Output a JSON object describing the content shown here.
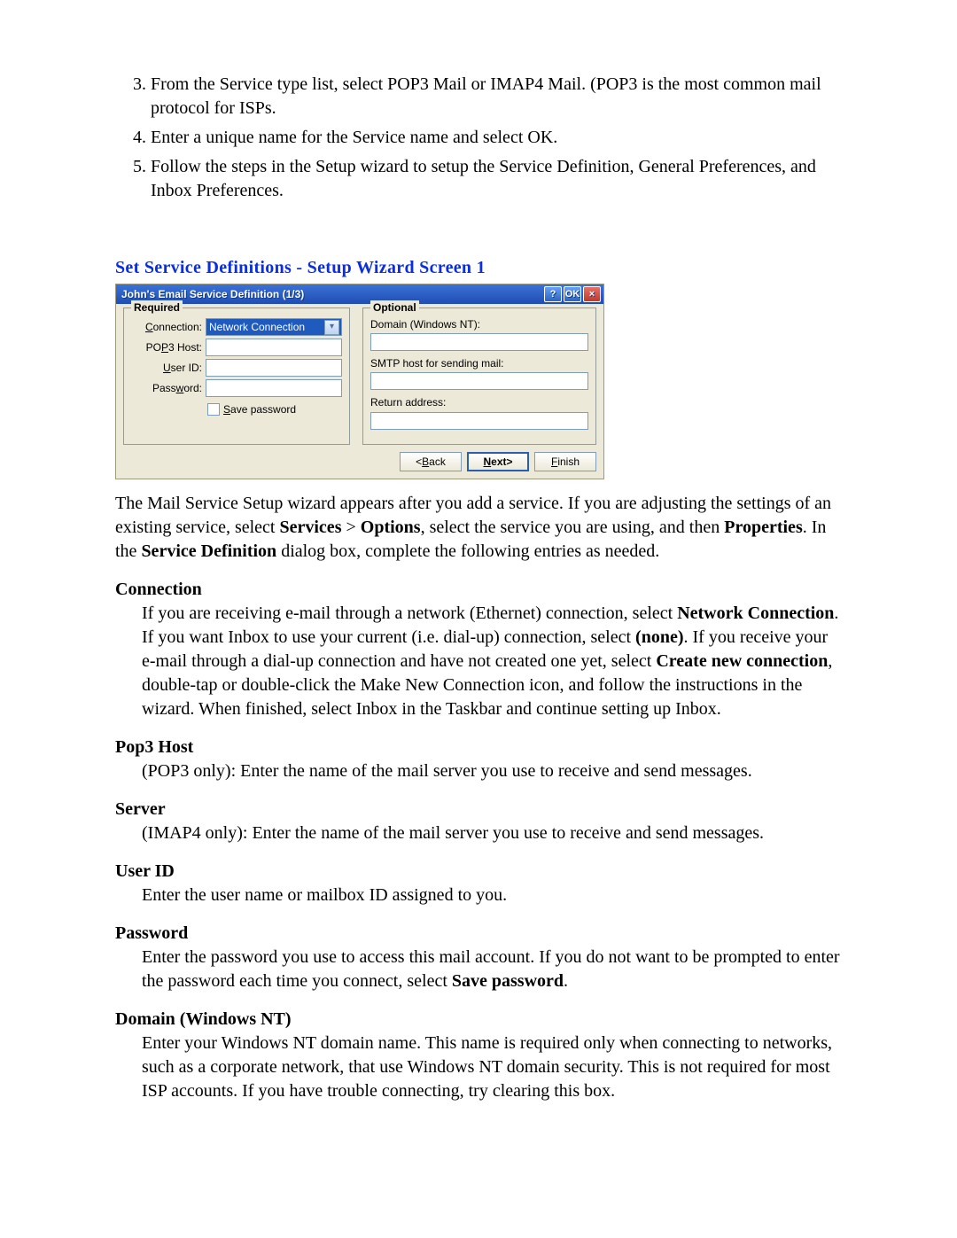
{
  "list": {
    "item3": "From the Service type list, select POP3 Mail or IMAP4 Mail. (POP3 is the most common mail protocol for ISPs.",
    "item4": "Enter a unique name for the Service name and select OK.",
    "item5": "Follow the steps in the Setup wizard to setup the Service Definition, General Preferences, and Inbox Preferences."
  },
  "section_heading": "Set Service Definitions  -   Setup Wizard Screen 1",
  "wizard": {
    "title": "John's Email Service Definition (1/3)",
    "help_btn": "?",
    "ok_btn": "OK",
    "close_btn": "×",
    "required_legend": "Required",
    "optional_legend": "Optional",
    "connection_label": "Connection:",
    "connection_value": "Network Connection",
    "pop3_label_pre": "PO",
    "pop3_label_u": "P",
    "pop3_label_post": "3 Host:",
    "userid_label_u": "U",
    "userid_label_post": "ser ID:",
    "password_label_pre": "Pass",
    "password_label_u": "w",
    "password_label_post": "ord:",
    "save_pw_u": "S",
    "save_pw_post": "ave password",
    "domain_label": "Domain (Windows NT):",
    "smtp_label": "SMTP host for sending mail:",
    "return_label": "Return address:",
    "back_btn_pre": "<",
    "back_btn_u": "B",
    "back_btn_post": "ack",
    "next_btn_pre": "",
    "next_btn_u": "N",
    "next_btn_post": "ext>",
    "finish_btn_u": "F",
    "finish_btn_post": "inish"
  },
  "para_after": {
    "p1_pre": "The Mail Service Setup wizard appears after you add a service.  If you are adjusting the settings of an existing service, select ",
    "p1_services": "Services",
    "p1_gt": " > ",
    "p1_options": "Options",
    "p1_mid1": ", select the service you are using, and then ",
    "p1_properties": "Properties",
    "p1_mid2": ". In the ",
    "p1_sdef": "Service Definition",
    "p1_post": " dialog box, complete the following entries as needed."
  },
  "defs": {
    "connection_title": "Connection",
    "connection_body_pre": "If you are receiving e-mail through a network (Ethernet) connection, select ",
    "connection_nc": "Network Connection",
    "connection_mid1": ". If you want Inbox to use your current (i.e. dial-up) connection, select ",
    "connection_none": "(none)",
    "connection_mid2": ". If you receive your e-mail through a dial-up connection and have not created one yet, select ",
    "connection_cnc": "Create new connection",
    "connection_post": ", double-tap or double-click the Make New Connection icon, and follow the instructions in the wizard. When finished, select Inbox in the Taskbar and continue setting up Inbox.",
    "pop3_title": "Pop3 Host",
    "pop3_body": "(POP3 only): Enter the name of the mail server you use to receive and send messages.",
    "server_title": "Server",
    "server_body": "(IMAP4 only): Enter the name of the mail server you use to receive and send messages.",
    "userid_title": "User ID",
    "userid_body": "Enter the user name or mailbox ID assigned to you.",
    "password_title": "Password",
    "password_body_pre": "Enter the password you use to access this mail account. If you do not want to be prompted to enter the password each time you connect, select ",
    "password_savepw": "Save password",
    "password_post": ".",
    "domain_title": "Domain (Windows NT)",
    "domain_body": "Enter your Windows NT domain name. This name is required only when connecting to networks, such as a corporate network, that use Windows NT domain security. This is not required for most ISP accounts. If you have trouble connecting, try clearing this box."
  }
}
